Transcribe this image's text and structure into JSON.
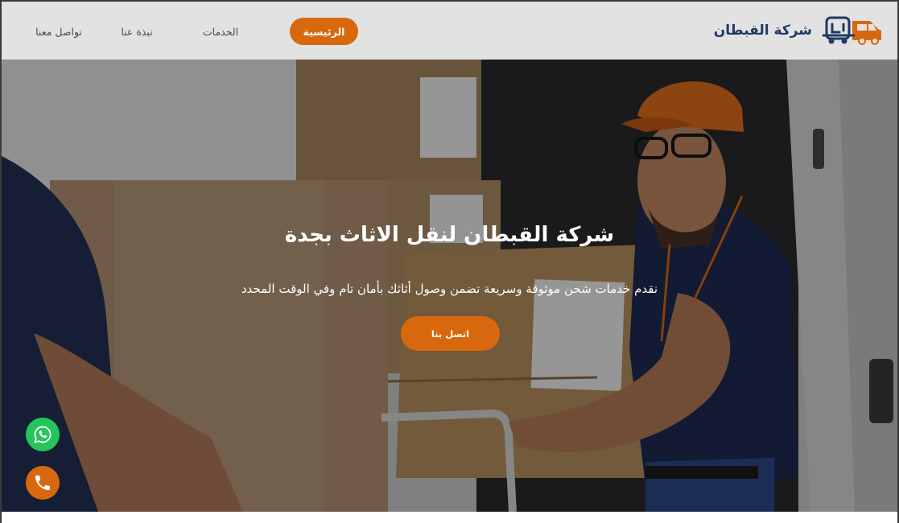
{
  "header": {
    "brand_name": "شركة القبطان",
    "logo_icon": "moving-truck-logo-icon",
    "nav": {
      "home": "الرئيسية",
      "services": "الخدمات",
      "about": "نبذة عنا",
      "contact": "تواصل معنا"
    },
    "active_item": "home"
  },
  "hero": {
    "title": "شركة القبطان لنقل الاثاث بجدة",
    "subtitle": "نقدم خدمات شحن موثوقة وسريعة تضمن وصول أثاثك بأمان تام وفي الوقت المحدد",
    "cta_label": "اتصل بنا",
    "background_image": "delivery-worker-carrying-box-photo"
  },
  "floating_buttons": {
    "whatsapp_icon": "whatsapp-icon",
    "phone_icon": "phone-icon"
  },
  "colors": {
    "accent": "#d8680d",
    "navbar_bg": "#e2e2e2",
    "brand_text": "#1f3a63",
    "whatsapp": "#25c55b"
  }
}
